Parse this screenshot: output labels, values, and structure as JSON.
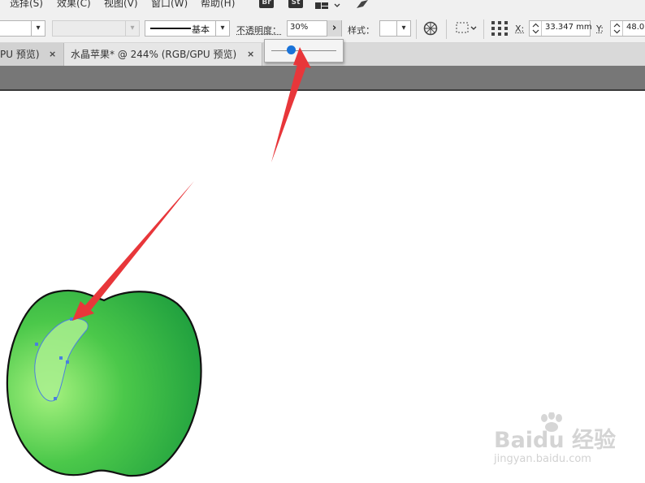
{
  "menubar": {
    "items": [
      "选择(S)",
      "效果(C)",
      "视图(V)",
      "窗口(W)",
      "帮助(H)"
    ],
    "badge_br": "Br",
    "badge_st": "St"
  },
  "controlbar": {
    "stroke_profile_label": "基本",
    "opacity_label": "不透明度：",
    "opacity_value": "30%",
    "opacity_arrow": "›",
    "style_label": "样式：",
    "x_label": "X:",
    "x_value": "33.347 mm",
    "y_label": "Y:",
    "y_value": "48.0"
  },
  "opacity_slider": {
    "value": 0.3
  },
  "tabs": [
    {
      "label": "PU 预览)",
      "close": "×"
    },
    {
      "label": "水晶苹果* @ 244% (RGB/GPU 预览)",
      "close": "×"
    }
  ],
  "watermark": {
    "brand": "Baidu 经验",
    "url": "jingyan.baidu.com"
  },
  "colors": {
    "apple_light": "#9ef07a",
    "apple_dark": "#1e9e3e",
    "arrow": "#e8363a",
    "selection": "#4a7fe0",
    "slider_knob": "#1a73d9"
  }
}
